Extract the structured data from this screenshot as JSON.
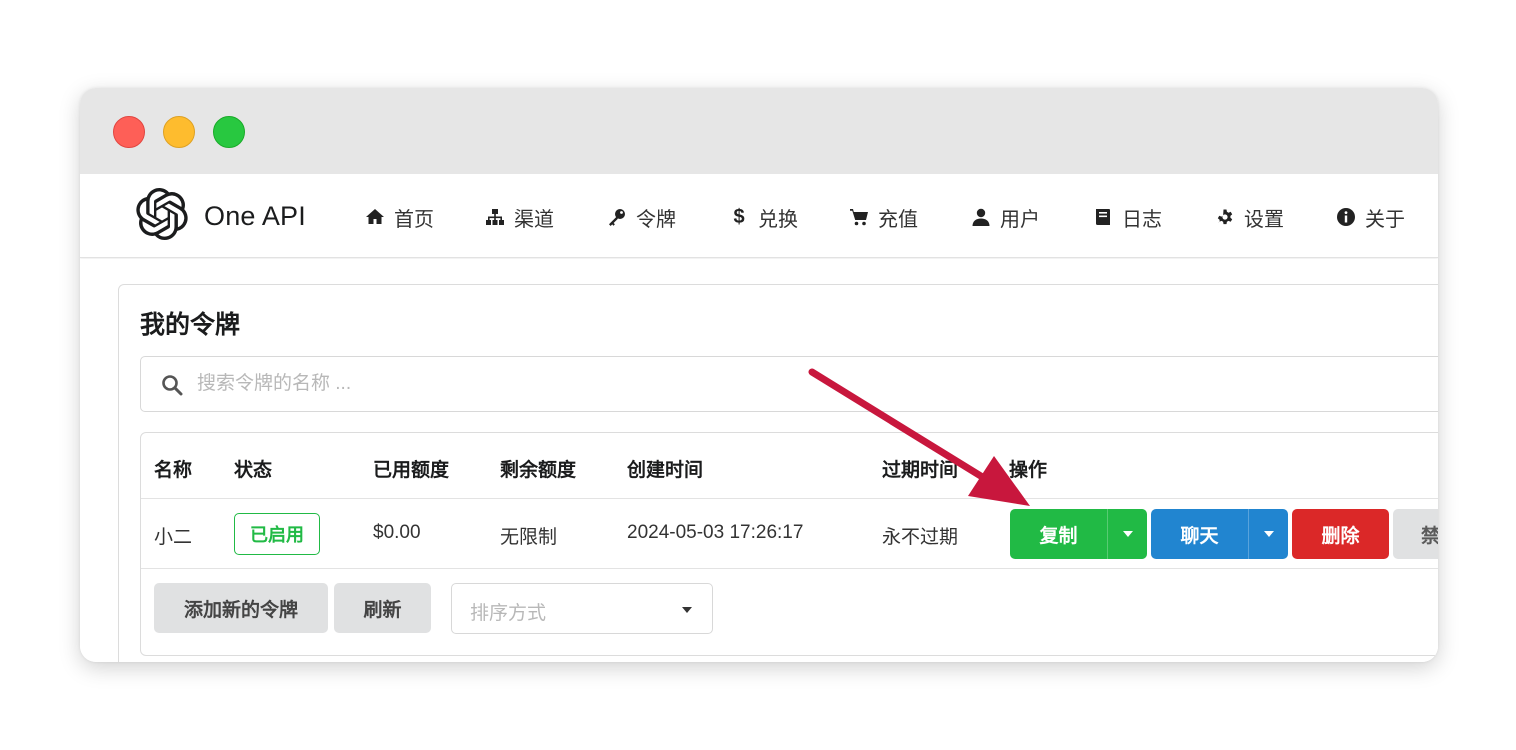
{
  "app": {
    "name": "One API"
  },
  "nav": [
    {
      "label": "首页",
      "icon": "home-icon"
    },
    {
      "label": "渠道",
      "icon": "sitemap-icon"
    },
    {
      "label": "令牌",
      "icon": "key-icon"
    },
    {
      "label": "兑换",
      "icon": "dollar-icon"
    },
    {
      "label": "充值",
      "icon": "cart-icon"
    },
    {
      "label": "用户",
      "icon": "user-icon"
    },
    {
      "label": "日志",
      "icon": "book-icon"
    },
    {
      "label": "设置",
      "icon": "gear-icon"
    },
    {
      "label": "关于",
      "icon": "info-icon"
    }
  ],
  "page": {
    "title": "我的令牌",
    "search": {
      "placeholder": "搜索令牌的名称 ...",
      "value": ""
    }
  },
  "table": {
    "headers": [
      "名称",
      "状态",
      "已用额度",
      "剩余额度",
      "创建时间",
      "过期时间",
      "操作"
    ],
    "rows": [
      {
        "name": "小二",
        "status": "已启用",
        "used": "$0.00",
        "remaining": "无限制",
        "created": "2024-05-03 17:26:17",
        "expires": "永不过期",
        "actions": {
          "copy": "复制",
          "chat": "聊天",
          "delete": "删除",
          "disable": "禁"
        }
      }
    ]
  },
  "footer": {
    "add_label": "添加新的令牌",
    "refresh_label": "刷新",
    "sort_placeholder": "排序方式"
  },
  "colors": {
    "green": "#21ba45",
    "blue": "#2185d0",
    "red": "#db2828",
    "annotation_arrow": "#c8173d"
  }
}
